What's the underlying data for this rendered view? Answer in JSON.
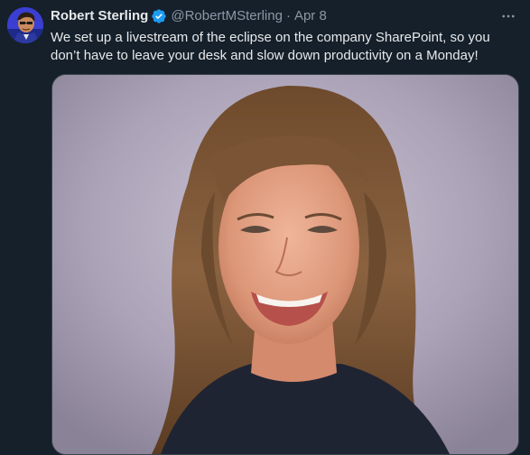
{
  "author": {
    "name": "Robert Sterling",
    "handle": "@RobertMSterling",
    "separator": "·",
    "date": "Apr 8",
    "verified": true,
    "avatar_icon": "avatar-cartoon-icon"
  },
  "menu": {
    "more_icon": "more-horizontal-icon"
  },
  "tweet": {
    "lines": [
      "We set up a livestream of the eclipse on the company SharePoint, so you",
      "don’t have to leave your desk and slow down productivity on a Monday!"
    ]
  },
  "media": {
    "kind": "photo",
    "subject": "smiling-woman-photo"
  },
  "colors": {
    "background": "#15202b",
    "text": "#e7e9ea",
    "secondary_text": "#8b98a5",
    "verified_badge": "#1d9bf0",
    "border": "#38444d"
  }
}
